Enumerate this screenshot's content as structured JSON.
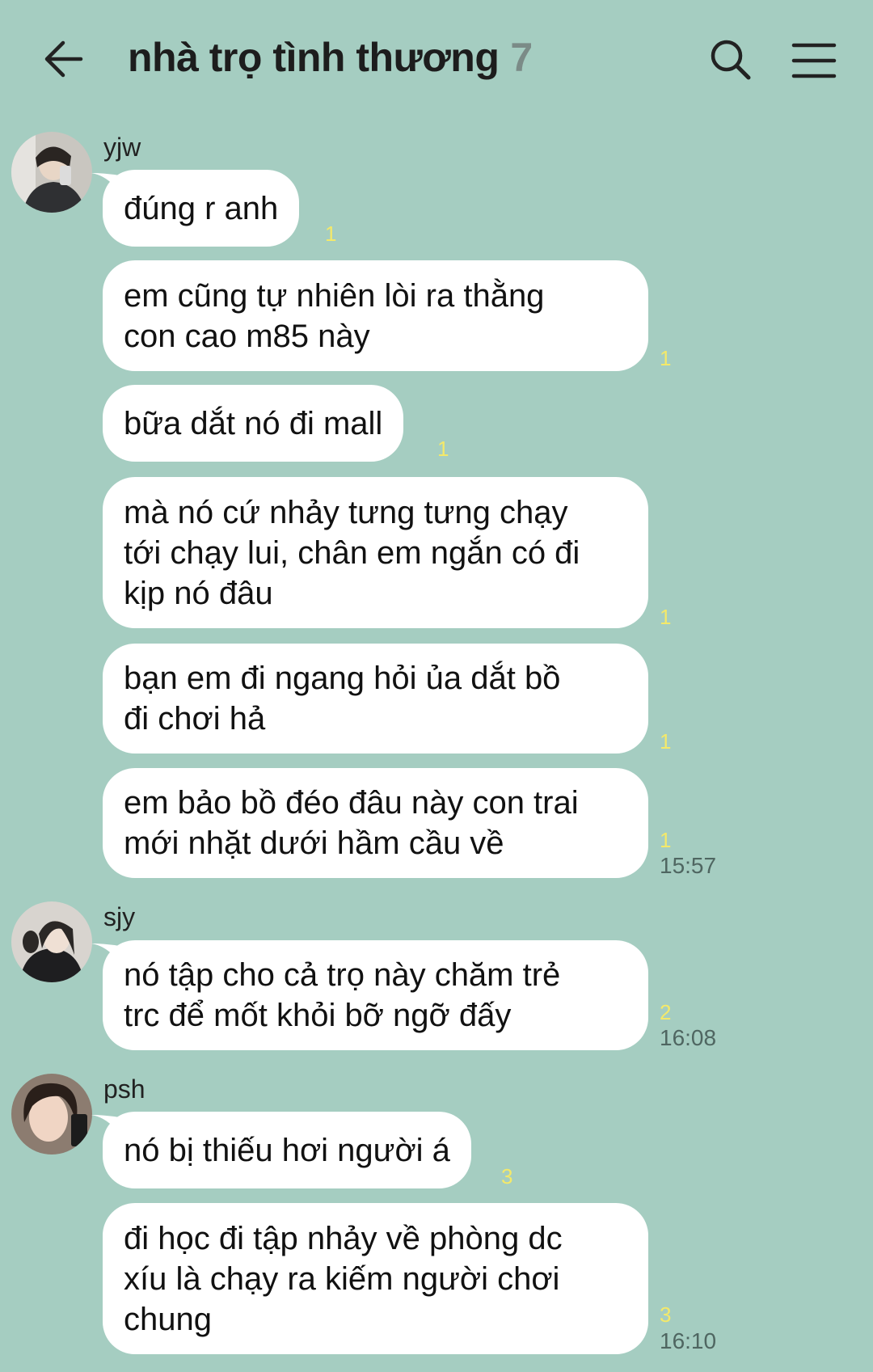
{
  "header": {
    "title": "nhà trọ tình thương",
    "member_count": "7"
  },
  "groups": [
    {
      "sender": "yjw",
      "messages": [
        {
          "text": "đúng r anh",
          "unread": "1"
        },
        {
          "text": "em cũng tự nhiên lòi ra thằng\ncon cao m85 này",
          "unread": "1"
        },
        {
          "text": "bữa dắt nó đi mall",
          "unread": "1"
        },
        {
          "text": "mà nó cứ nhảy tưng tưng chạy\ntới chạy lui, chân em ngắn có đi\nkịp nó đâu",
          "unread": "1"
        },
        {
          "text": "bạn em đi ngang hỏi ủa dắt bồ\nđi chơi hả",
          "unread": "1"
        },
        {
          "text": "em bảo bồ đéo đâu này con trai\nmới nhặt dưới hầm cầu về",
          "unread": "1",
          "time": "15:57"
        }
      ]
    },
    {
      "sender": "sjy",
      "messages": [
        {
          "text": "nó tập cho cả trọ này chăm trẻ\ntrc để mốt khỏi bỡ ngỡ đấy",
          "unread": "2",
          "time": "16:08"
        }
      ]
    },
    {
      "sender": "psh",
      "messages": [
        {
          "text": "nó bị thiếu hơi người á",
          "unread": "3"
        },
        {
          "text": "đi học đi tập nhảy về phòng dc\nxíu là chạy ra kiếm người chơi\nchung",
          "unread": "3",
          "time": "16:10"
        }
      ]
    }
  ]
}
